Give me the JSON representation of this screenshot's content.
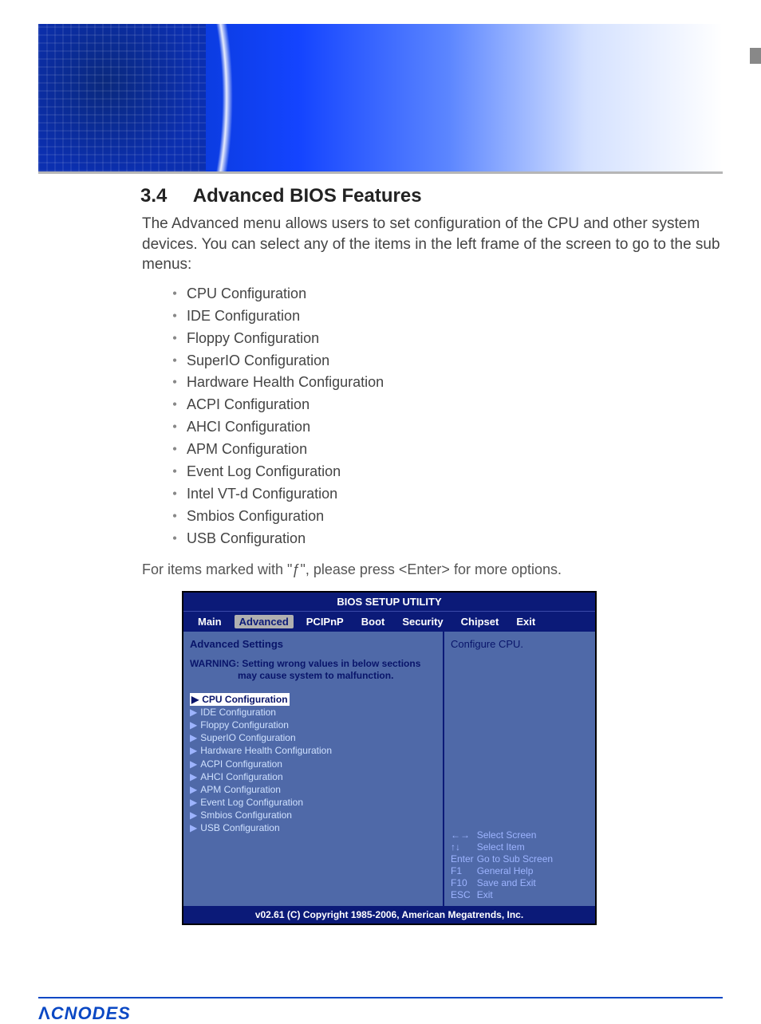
{
  "section": {
    "number": "3.4",
    "title": "Advanced BIOS Features"
  },
  "intro": "The Advanced menu allows users to set configuration of the CPU and other system devices. You can select any of the items in the left frame of the screen to go to the sub menus:",
  "config_list": [
    "CPU Configuration",
    "IDE Configuration",
    "Floppy Configuration",
    "SuperIO Configuration",
    "Hardware Health Configuration",
    "ACPI Configuration",
    "AHCI Configuration",
    "APM Configuration",
    "Event Log Configuration",
    "Intel VT-d Configuration",
    "Smbios Configuration",
    "USB Configuration"
  ],
  "note": "For items marked with \"ƒ\", please press <Enter> for more options.",
  "bios": {
    "title": "BIOS SETUP UTILITY",
    "tabs": [
      "Main",
      "Advanced",
      "PCIPnP",
      "Boot",
      "Security",
      "Chipset",
      "Exit"
    ],
    "active_tab": "Advanced",
    "heading": "Advanced Settings",
    "warning_line1": "WARNING: Setting wrong values in below sections",
    "warning_line2": "may cause system to malfunction.",
    "menu": [
      "CPU Configuration",
      "IDE Configuration",
      "Floppy Configuration",
      "SuperIO Configuration",
      "Hardware Health Configuration",
      "ACPI Configuration",
      "AHCI Configuration",
      "APM Configuration",
      "Event Log Configuration",
      "Smbios Configuration",
      "USB Configuration"
    ],
    "selected_menu": "CPU Configuration",
    "help_text": "Configure CPU.",
    "keys": [
      {
        "key": "←→",
        "desc": "Select Screen"
      },
      {
        "key": "↑↓",
        "desc": "Select Item"
      },
      {
        "key": "Enter",
        "desc": "Go to Sub Screen"
      },
      {
        "key": "F1",
        "desc": "General Help"
      },
      {
        "key": "F10",
        "desc": "Save and Exit"
      },
      {
        "key": "ESC",
        "desc": "Exit"
      }
    ],
    "footer": "v02.61 (C) Copyright 1985-2006, American Megatrends, Inc."
  },
  "brand": "CNODES"
}
